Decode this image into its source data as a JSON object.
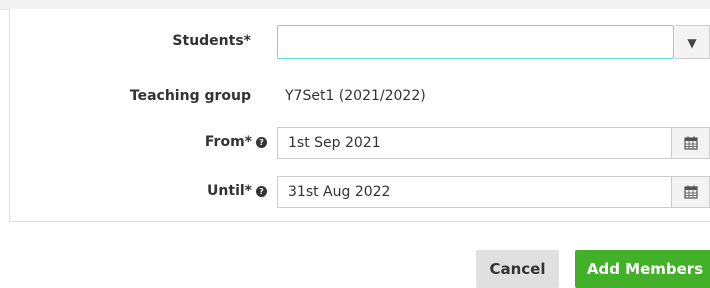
{
  "form": {
    "students": {
      "label": "Students*",
      "value": "",
      "arrow": "▼"
    },
    "teaching_group": {
      "label": "Teaching group",
      "value": "Y7Set1 (2021/2022)"
    },
    "from": {
      "label": "From*",
      "help_icon": "question-circle",
      "value": "1st Sep 2021",
      "calendar_icon": "calendar"
    },
    "until": {
      "label": "Until*",
      "help_icon": "question-circle",
      "value": "31st Aug 2022",
      "calendar_icon": "calendar"
    }
  },
  "actions": {
    "cancel_label": "Cancel",
    "add_label": "Add Members"
  },
  "colors": {
    "primary_button": "#43b02a",
    "focus_border": "#66d9e8"
  }
}
